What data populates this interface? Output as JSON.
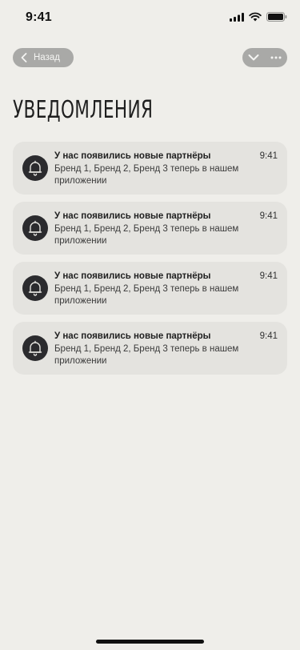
{
  "status_bar": {
    "time": "9:41"
  },
  "nav": {
    "back_label": "Назад"
  },
  "page": {
    "title": "УВЕДОМЛЕНИЯ"
  },
  "notifications": [
    {
      "title": "У нас появились новые партнёры",
      "time": "9:41",
      "body": "Бренд 1, Бренд 2, Бренд 3 теперь в нашем приложении",
      "icon": "bell-icon"
    },
    {
      "title": "У нас появились новые партнёры",
      "time": "9:41",
      "body": "Бренд 1, Бренд 2, Бренд 3 теперь в нашем приложении",
      "icon": "bell-icon"
    },
    {
      "title": "У нас появились новые партнёры",
      "time": "9:41",
      "body": "Бренд 1, Бренд 2, Бренд 3 теперь в нашем приложении",
      "icon": "bell-icon"
    },
    {
      "title": "У нас появились новые партнёры",
      "time": "9:41",
      "body": "Бренд 1, Бренд 2, Бренд 3 теперь в нашем приложении",
      "icon": "bell-icon"
    }
  ],
  "colors": {
    "background": "#efeeea",
    "card": "#e4e3df",
    "pill": "#a9a9a7",
    "icon_bg": "#2b2b2e"
  }
}
